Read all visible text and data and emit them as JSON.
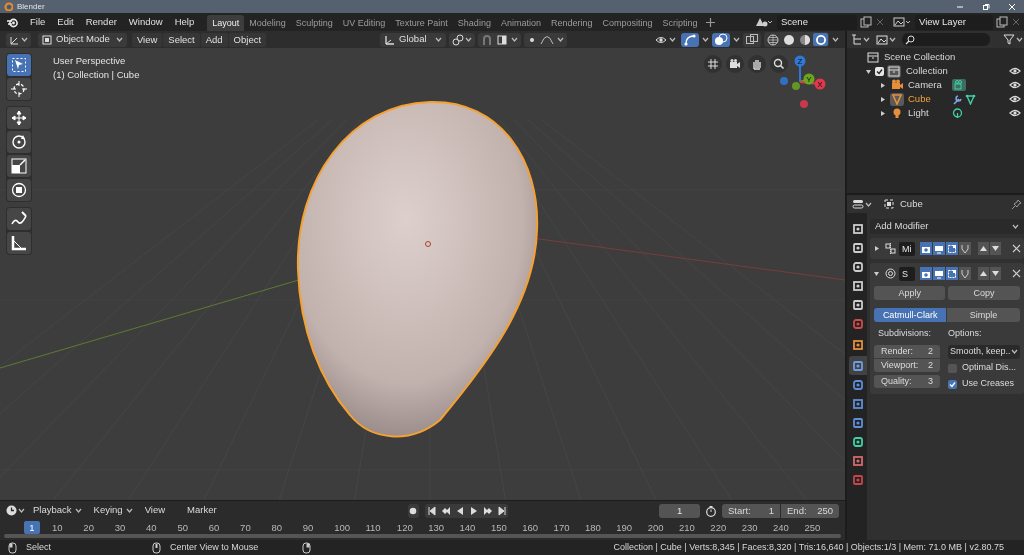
{
  "window": {
    "title": "Blender"
  },
  "menu": [
    "File",
    "Edit",
    "Render",
    "Window",
    "Help"
  ],
  "workspaces": [
    {
      "label": "Layout",
      "selected": true
    },
    {
      "label": "Modeling",
      "selected": false
    },
    {
      "label": "Sculpting",
      "selected": false
    },
    {
      "label": "UV Editing",
      "selected": false
    },
    {
      "label": "Texture Paint",
      "selected": false
    },
    {
      "label": "Shading",
      "selected": false
    },
    {
      "label": "Animation",
      "selected": false
    },
    {
      "label": "Rendering",
      "selected": false
    },
    {
      "label": "Compositing",
      "selected": false
    },
    {
      "label": "Scripting",
      "selected": false
    }
  ],
  "scene": "Scene",
  "view_layer": "View Layer",
  "viewport": {
    "mode": "Object Mode",
    "menus": [
      "View",
      "Select",
      "Add",
      "Object"
    ],
    "orientation": "Global",
    "toggles": [
      {
        "kind": "gizmo",
        "on": true
      },
      {
        "kind": "overlay",
        "on": true
      },
      {
        "kind": "xray",
        "on": false
      }
    ],
    "shading": [
      {
        "kind": "wireframe",
        "selected": false
      },
      {
        "kind": "solid",
        "selected": false
      },
      {
        "kind": "material",
        "selected": false
      },
      {
        "kind": "rendered",
        "selected": true
      }
    ],
    "view_name": "User Perspective",
    "context": "(1) Collection | Cube",
    "tools": [
      {
        "kind": "select",
        "selected": true
      },
      {
        "kind": "cursor",
        "selected": false
      },
      {
        "kind": "move",
        "selected": false
      },
      {
        "kind": "rotate",
        "selected": false
      },
      {
        "kind": "scale",
        "selected": false
      },
      {
        "kind": "transform",
        "selected": false
      },
      {
        "kind": "annotate",
        "selected": false
      },
      {
        "kind": "measure",
        "selected": false
      }
    ],
    "axes": [
      {
        "label": "Z",
        "color": "#2f78d8"
      },
      {
        "label": "Y",
        "color": "#6aa61e"
      },
      {
        "label": "X",
        "color": "#e0384d"
      }
    ]
  },
  "outliner": {
    "root": "Scene Collection",
    "children": [
      {
        "label": "Collection",
        "kind": "collection",
        "checked": true,
        "expanded": true,
        "selected": false,
        "visible": true,
        "children": [
          {
            "label": "Camera",
            "kind": "camera",
            "expanded": false,
            "selected": false,
            "visible": true
          },
          {
            "label": "Cube",
            "kind": "mesh",
            "expanded": false,
            "selected": true,
            "visible": true
          },
          {
            "label": "Light",
            "kind": "light",
            "expanded": false,
            "selected": false,
            "visible": true
          }
        ]
      }
    ]
  },
  "properties": {
    "object": "Cube",
    "tabs": [
      {
        "kind": "tool",
        "selected": false
      },
      {
        "kind": "render",
        "selected": false
      },
      {
        "kind": "output",
        "selected": false
      },
      {
        "kind": "view_layer",
        "selected": false
      },
      {
        "kind": "scene",
        "selected": false
      },
      {
        "kind": "world",
        "selected": false
      },
      {
        "kind": "object",
        "selected": false
      },
      {
        "kind": "modifier",
        "selected": true
      },
      {
        "kind": "particles",
        "selected": false
      },
      {
        "kind": "physics",
        "selected": false
      },
      {
        "kind": "constraints",
        "selected": false
      },
      {
        "kind": "data",
        "selected": false
      },
      {
        "kind": "material",
        "selected": false
      },
      {
        "kind": "texture",
        "selected": false
      }
    ],
    "add_modifier": "Add Modifier",
    "modifiers": [
      {
        "name": "Mi",
        "kind": "mirror",
        "expanded": false,
        "toggles": [
          {
            "on": true
          },
          {
            "on": true
          },
          {
            "on": true
          },
          {
            "on": false
          }
        ]
      },
      {
        "name": "S",
        "kind": "subsurf",
        "expanded": true,
        "toggles": [
          {
            "on": true
          },
          {
            "on": true
          },
          {
            "on": true
          },
          {
            "on": false
          }
        ]
      }
    ],
    "actions": [
      "Apply",
      "Copy"
    ],
    "types": [
      {
        "label": "Catmull-Clark",
        "selected": true
      },
      {
        "label": "Simple",
        "selected": false
      }
    ],
    "subdivisions_label": "Subdivisions:",
    "fields": [
      {
        "label": "Render:",
        "value": "2"
      },
      {
        "label": "Viewport:",
        "value": "2"
      },
      {
        "label": "Quality:",
        "value": "3"
      }
    ],
    "options_label": "Options:",
    "uv_smooth": "Smooth, keep..",
    "checkboxes": [
      {
        "label": "Optimal Dis...",
        "checked": false
      },
      {
        "label": "Use Creases",
        "checked": true
      }
    ]
  },
  "timeline": {
    "menus": [
      {
        "label": "Playback",
        "dropdown": true
      },
      {
        "label": "Keying",
        "dropdown": true
      },
      {
        "label": "View",
        "dropdown": false
      },
      {
        "label": "Marker",
        "dropdown": false
      }
    ],
    "current_frame": "1",
    "start_label": "Start:",
    "start": "1",
    "end_label": "End:",
    "end": "250",
    "ruler": [
      "1",
      "10",
      "20",
      "30",
      "40",
      "50",
      "60",
      "70",
      "80",
      "90",
      "100",
      "110",
      "120",
      "130",
      "140",
      "150",
      "160",
      "170",
      "180",
      "190",
      "200",
      "210",
      "220",
      "230",
      "240",
      "250"
    ]
  },
  "status_bar": {
    "hints": [
      {
        "kind": "left",
        "label": "Select"
      },
      {
        "kind": "middle",
        "label": "Center View to Mouse"
      },
      {
        "kind": "right"
      }
    ],
    "stats": "Collection | Cube | Verts:8,345 | Faces:8,320 | Tris:16,640 | Objects:1/3 | Mem: 71.0 MB | v2.80.75"
  }
}
